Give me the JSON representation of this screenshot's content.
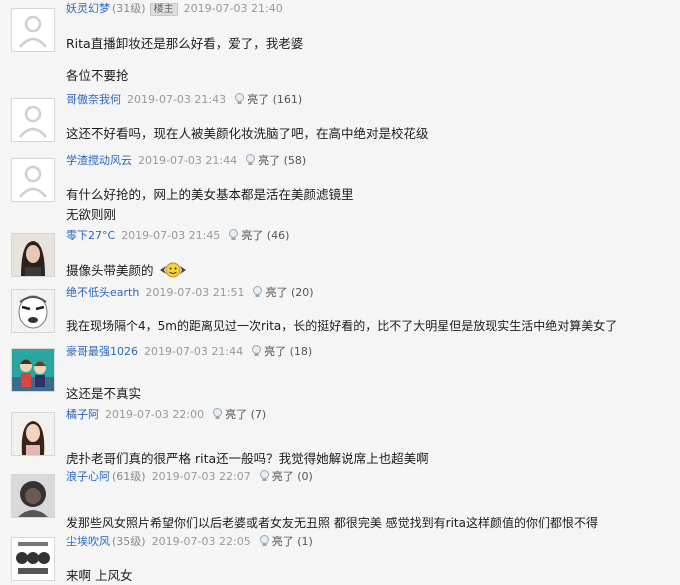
{
  "comments": [
    {
      "user": "妖灵幻梦",
      "level": "(31级)",
      "badge": "楼主",
      "date": "2019-07-03 21:40",
      "likes": "",
      "lines": [
        "Rita直播卸妆还是那么好看，爱了，我老婆",
        "各位不要抢"
      ]
    },
    {
      "user": "哥傲奈我何",
      "level": "",
      "badge": "",
      "date": "2019-07-03 21:43",
      "likes": "亮了 (161)",
      "lines": [
        "这还不好看吗，现在人被美颜化妆洗脑了吧，在高中绝对是校花级"
      ]
    },
    {
      "user": "学渣搅动风云",
      "level": "",
      "badge": "",
      "date": "2019-07-03 21:44",
      "likes": "亮了 (58)",
      "lines": [
        "有什么好抢的，网上的美女基本都是活在美颜滤镜里",
        "无欲则刚"
      ]
    },
    {
      "user": "零下27°C",
      "level": "",
      "badge": "",
      "date": "2019-07-03 21:45",
      "likes": "亮了 (46)",
      "lines": [
        "摄像头带美颜的"
      ]
    },
    {
      "user": "绝不低头earth",
      "level": "",
      "badge": "",
      "date": "2019-07-03 21:51",
      "likes": "亮了 (20)",
      "lines": [
        "我在现场隔个4，5m的距离见过一次rita，长的挺好看的，比不了大明星但是放现实生活中绝对算美女了"
      ]
    },
    {
      "user": "豪哥最强1026",
      "level": "",
      "badge": "",
      "date": "2019-07-03 21:44",
      "likes": "亮了 (18)",
      "lines": [
        "这还是不真实"
      ]
    },
    {
      "user": "橘子阿",
      "level": "",
      "badge": "",
      "date": "2019-07-03 22:00",
      "likes": "亮了 (7)",
      "lines": [
        "虎扑老哥们真的很严格 rita还一般吗？我觉得她解说席上也超美啊"
      ]
    },
    {
      "user": "浪子心阿",
      "level": "(61级)",
      "badge": "",
      "date": "2019-07-03 22:07",
      "likes": "亮了 (0)",
      "lines": [
        "发那些风女照片希望你们以后老婆或者女友无丑照 都很完美 感觉找到有rita这样颜值的你们都恨不得"
      ]
    },
    {
      "user": "尘埃吹风",
      "level": "(35级)",
      "badge": "",
      "date": "2019-07-03 22:05",
      "likes": "亮了 (1)",
      "lines": [
        "来啊 上风女"
      ]
    }
  ],
  "icons": {
    "avatar": "avatar-icon",
    "like": "lightbulb-icon",
    "emoji": "emoji-icon"
  },
  "colors": {
    "username": "#2a66c0",
    "background": "#f5f5f5",
    "text": "#1c1c1c",
    "meta": "#999999"
  }
}
